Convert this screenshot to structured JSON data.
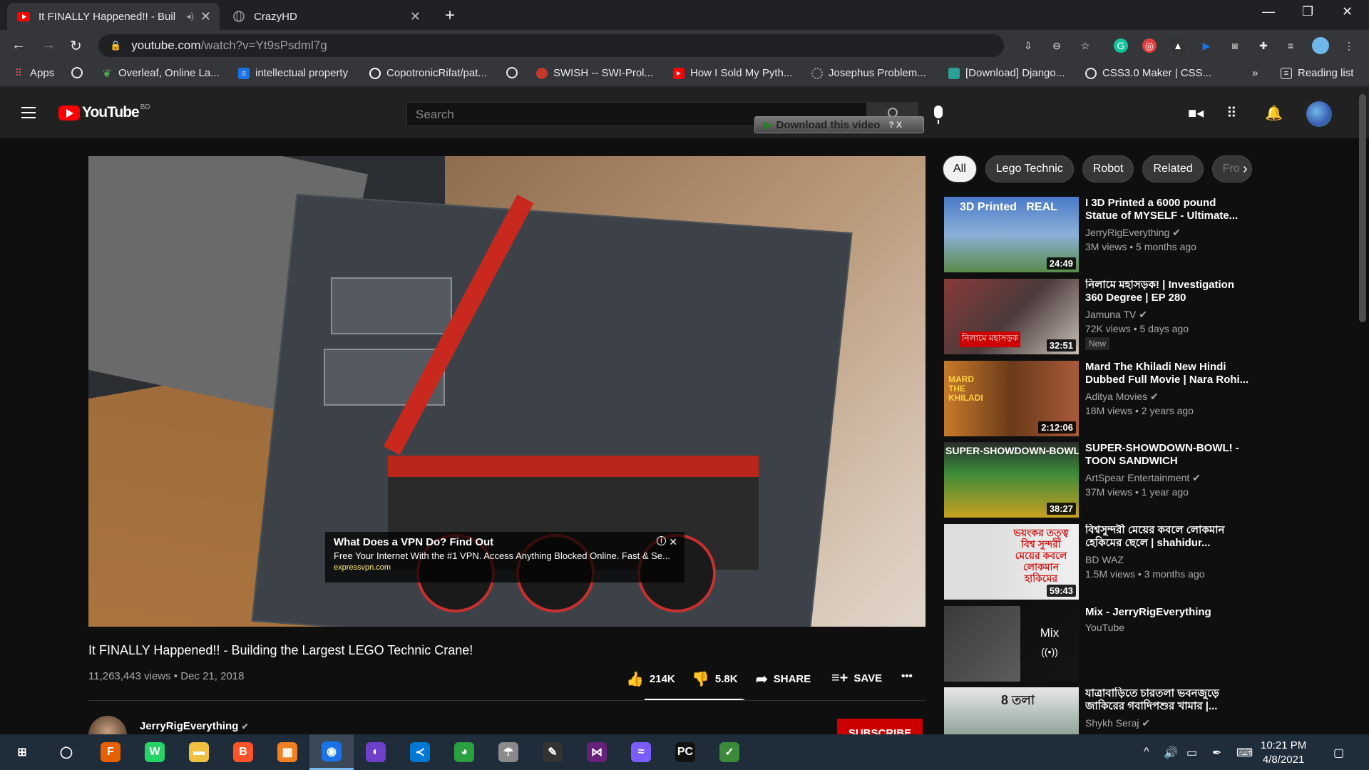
{
  "browser": {
    "tabs": [
      {
        "title": "It FINALLY Happened!! - Buil",
        "favicon": "youtube-icon",
        "active": true,
        "audio": "speaker-icon"
      },
      {
        "title": "CrazyHD",
        "favicon": "globe-icon",
        "active": false
      }
    ],
    "new_tab": "+",
    "window_controls": {
      "minimize": "—",
      "restore": "❐",
      "close": "✕"
    },
    "url_domain": "youtube.com",
    "url_path": "/watch?v=Yt9sPsdml7g",
    "bookmarks": [
      {
        "label": "Apps",
        "icon": "apps-grid-icon",
        "color": "#e74c3c"
      },
      {
        "label": "",
        "icon": "globe-icon",
        "color": "#9aa0a6"
      },
      {
        "label": "Overleaf, Online La...",
        "icon": "overleaf-icon",
        "color": "#4caf50"
      },
      {
        "label": "intellectual property",
        "icon": "s-icon",
        "color": "#1a73e8"
      },
      {
        "label": "CopotronicRifat/pat...",
        "icon": "github-icon",
        "color": "#ffffff"
      },
      {
        "label": "",
        "icon": "globe-icon",
        "color": "#9aa0a6"
      },
      {
        "label": "SWISH -- SWI-Prol...",
        "icon": "swish-icon",
        "color": "#c0392b"
      },
      {
        "label": "How I Sold My Pyth...",
        "icon": "youtube-icon",
        "color": "#ff0000"
      },
      {
        "label": "Josephus Problem...",
        "icon": "loading-icon",
        "color": "#9aa0a6"
      },
      {
        "label": "[Download] Django...",
        "icon": "django-icon",
        "color": "#2aa198"
      },
      {
        "label": "CSS3.0 Maker | CSS...",
        "icon": "globe-icon",
        "color": "#9aa0a6"
      }
    ],
    "bookmarks_more": "»",
    "reading_list": "Reading list"
  },
  "youtube": {
    "logo_text": "YouTube",
    "country_code": "BD",
    "search_placeholder": "Search",
    "download_overlay": "Download this video",
    "download_overlay_help": "? X",
    "video": {
      "title": "It FINALLY Happened!! - Building the Largest LEGO Technic Crane!",
      "views": "11,263,443 views",
      "date": "Dec 21, 2018",
      "likes": "214K",
      "dislikes": "5.8K",
      "share": "SHARE",
      "save": "SAVE",
      "more": "•••",
      "like_ratio": 0.97
    },
    "ad": {
      "title": "What Does a VPN Do? Find Out",
      "description": "Free Your Internet With the #1 VPN. Access Anything Blocked Online. Fast & Se...",
      "url": "expressvpn.com",
      "info": "i",
      "close": "✕"
    },
    "channel": {
      "name": "JerryRigEverything",
      "verified": "✔",
      "subscribe": "SUBSCRIBE"
    },
    "chips": [
      "All",
      "Lego Technic",
      "Robot",
      "Related",
      "Fro"
    ],
    "chip_arrow": "›",
    "recommendations": [
      {
        "title": "I 3D Printed a 6000 pound Statue of MYSELF - Ultimate...",
        "channel": "JerryRigEverything ✔",
        "meta": "3M views • 5 months ago",
        "duration": "24:49",
        "thumb_text": "3D Printed   REAL",
        "thumb_color": "#5a8ac8"
      },
      {
        "title": "নিলামে মহাসড়ক! | Investigation 360 Degree | EP 280",
        "channel": "Jamuna TV ✔",
        "meta": "72K views • 5 days ago",
        "duration": "32:51",
        "badge": "New",
        "thumb_text": "নিলামে মহাসড়ক",
        "thumb_color": "#7a3a3a"
      },
      {
        "title": "Mard The Khiladi New Hindi Dubbed Full Movie | Nara Rohi...",
        "channel": "Aditya Movies ✔",
        "meta": "18M views • 2 years ago",
        "duration": "2:12:06",
        "thumb_text": "MARD THE KHILADI",
        "thumb_color": "#8a4a1a"
      },
      {
        "title": "SUPER-SHOWDOWN-BOWL! - TOON SANDWICH",
        "channel": "ArtSpear Entertainment ✔",
        "meta": "37M views • 1 year ago",
        "duration": "38:27",
        "thumb_text": "SUPER-SHOWDOWN-BOWL!",
        "thumb_color": "#3a7a3a"
      },
      {
        "title": "বিশ্বসুন্দরী মেয়ের কবলে লোকমান হেকিমের ছেলে | shahidur...",
        "channel": "BD WAZ",
        "meta": "1.5M views • 3 months ago",
        "duration": "59:43",
        "thumb_text": "ভয়ংকর তত্ত্ব বিশ্ব সুন্দরী মেয়ের কবলে লোকমান হাকিমের",
        "thumb_color": "#c83030"
      },
      {
        "title": "Mix - JerryRigEverything",
        "channel": "YouTube",
        "meta": "",
        "duration": "",
        "mix": "Mix",
        "mix_icon": "((•))",
        "thumb_color": "#4a4a4a"
      },
      {
        "title": "যাত্রাবাড়িতে চারতলা ভবনজুড়ে জাকিরের গবাদিপশুর খামার |...",
        "channel": "Shykh Seraj ✔",
        "meta": "",
        "duration": "",
        "thumb_text": "8 তলা",
        "thumb_color": "#5a7a6a"
      }
    ]
  },
  "taskbar": {
    "apps": [
      {
        "name": "windows-start-icon",
        "glyph": "⊞",
        "color": "transparent"
      },
      {
        "name": "search-icon",
        "glyph": "◯",
        "color": "transparent"
      },
      {
        "name": "firefox-icon",
        "glyph": "F",
        "color": "#e66000"
      },
      {
        "name": "whatsapp-icon",
        "glyph": "W",
        "color": "#25d366"
      },
      {
        "name": "file-explorer-icon",
        "glyph": "▬",
        "color": "#f0c040"
      },
      {
        "name": "brave-icon",
        "glyph": "B",
        "color": "#fb542b"
      },
      {
        "name": "clip-app-icon",
        "glyph": "▦",
        "color": "#f08020"
      },
      {
        "name": "chrome-icon",
        "glyph": "◉",
        "color": "#1a73e8",
        "active": true
      },
      {
        "name": "github-desktop-icon",
        "glyph": "◐",
        "color": "#6e40c9"
      },
      {
        "name": "vscode-icon",
        "glyph": "≺",
        "color": "#0078d4"
      },
      {
        "name": "app-icon-9",
        "glyph": "◕",
        "color": "#2aa040"
      },
      {
        "name": "app-icon-10",
        "glyph": "☂",
        "color": "#8a8a8a"
      },
      {
        "name": "inkscape-icon",
        "glyph": "✎",
        "color": "#333"
      },
      {
        "name": "visual-studio-icon",
        "glyph": "⋈",
        "color": "#68217a"
      },
      {
        "name": "messenger-icon",
        "glyph": "≈",
        "color": "#7b5cff"
      },
      {
        "name": "pycharm-icon",
        "glyph": "PC",
        "color": "#111"
      },
      {
        "name": "notepad-icon",
        "glyph": "✓",
        "color": "#3a8a3a"
      }
    ],
    "tray": {
      "up_arrow": "^",
      "volume": "🔊",
      "network": "▭",
      "pen": "✒",
      "keyboard": "⌨"
    },
    "time": "10:21 PM",
    "date": "4/8/2021",
    "notification": "▢"
  }
}
